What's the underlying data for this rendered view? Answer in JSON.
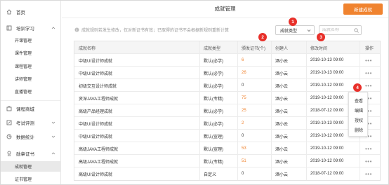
{
  "sidebar": {
    "items": [
      {
        "label": "首页",
        "icon": "home-icon"
      },
      {
        "label": "培训学习",
        "icon": "book-icon"
      },
      {
        "label": "课程商城",
        "icon": "cart-icon"
      },
      {
        "label": "考试评测",
        "icon": "edit-icon"
      },
      {
        "label": "数据统计",
        "icon": "chart-icon"
      },
      {
        "label": "勋章证书",
        "icon": "medal-icon"
      }
    ],
    "training_sub": [
      "开课管理",
      "课件管理",
      "课程管理",
      "讲师管理",
      "直播管理"
    ],
    "cert_sub": [
      "成就管理",
      "证书管理"
    ]
  },
  "header": {
    "title": "成就管理",
    "new_button": "新建成就"
  },
  "notice": "成就规则若发生修改，仅对新证书有效；已取得的证书不会根据新规则重新计算",
  "filter": {
    "select_value": "成就类型",
    "search_placeholder": "成就名称"
  },
  "table": {
    "headers": [
      "成就名称",
      "成就类型",
      "颁发证书(个)",
      "创建人",
      "修改时间",
      "操作"
    ],
    "rows": [
      {
        "name": "中级UI设计师成就",
        "type": "默认(必学)",
        "issued": "6",
        "creator": "酒小云",
        "time": "2019-10-13  09:00"
      },
      {
        "name": "中级UI设计师成就",
        "type": "默认(必学)",
        "issued": "26",
        "creator": "酒小云",
        "time": "2019-10-13  09:00"
      },
      {
        "name": "初级交互设计师成就",
        "type": "默认(必学)",
        "issued": "0",
        "creator": "酒小云",
        "time": "2019-10-12  09:00"
      },
      {
        "name": "资深JAVA工程师成就",
        "type": "默认(专精)",
        "issued": "75",
        "creator": "酒小云",
        "time": "2019-10-12  09:00"
      },
      {
        "name": "高级产品经理成就",
        "type": "默认(必学)",
        "issued": "25",
        "creator": "酒小云",
        "time": "2018-07-12  09:00"
      },
      {
        "name": "中级UI设计师成就",
        "type": "默认(必学)",
        "issued": "2",
        "creator": "酒小云",
        "time": "2019-10-13  09:00"
      },
      {
        "name": "中级UI设计师成就",
        "type": "默认(宣理)",
        "issued": "0",
        "creator": "酒小云",
        "time": "2019-10-12  09:00"
      },
      {
        "name": "高级JAVA工程师成就",
        "type": "默认(宣理)",
        "issued": "53",
        "creator": "酒小云",
        "time": "2019-10-12  09:00"
      },
      {
        "name": "高级JAVA工程师成就",
        "type": "默认(专精)",
        "issued": "51",
        "creator": "酒小云",
        "time": "2019-10-12  09:00"
      },
      {
        "name": "高级UI设计师成就",
        "type": "自定义",
        "issued": "0",
        "creator": "酒小云",
        "time": "2018-07-12  09:00"
      }
    ],
    "ops_label": "•••"
  },
  "menu": [
    "查看",
    "编辑",
    "授权",
    "删除"
  ],
  "badges": [
    "1",
    "2",
    "3",
    "4"
  ],
  "colors": {
    "accent": "#f0832f",
    "badge": "#e8302a",
    "active_bg": "#e9e9e9"
  }
}
